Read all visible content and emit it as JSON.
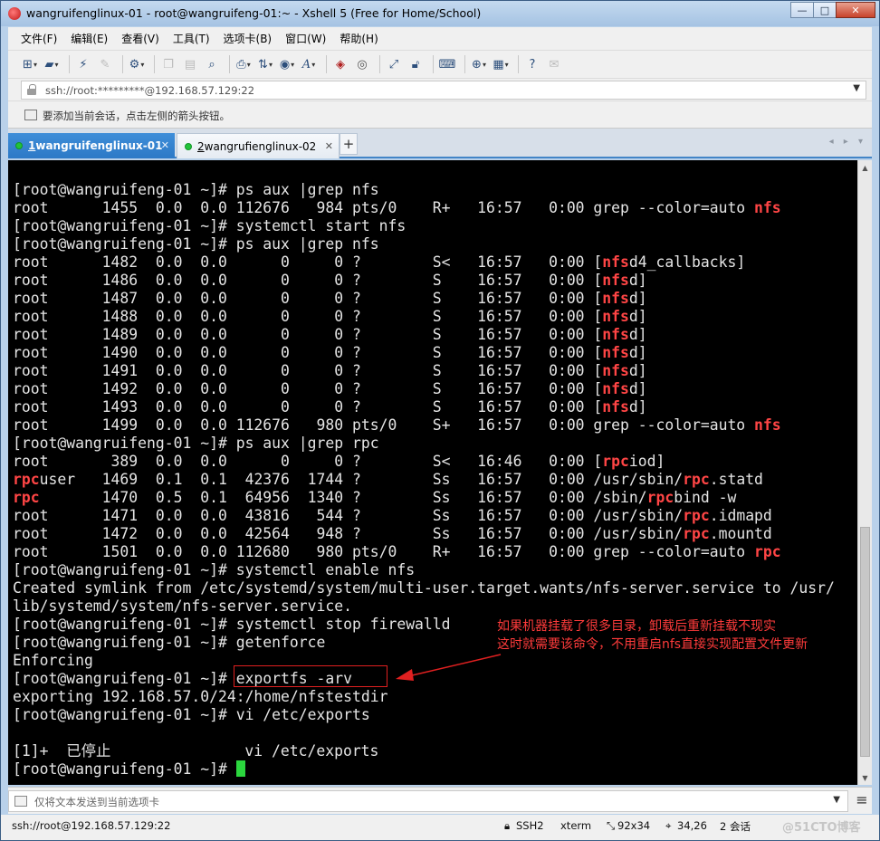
{
  "window": {
    "title": "wangruifenglinux-01 - root@wangruifeng-01:~ - Xshell 5 (Free for Home/School)",
    "buttons": {
      "minimize": "—",
      "maximize": "□",
      "close": "✕"
    }
  },
  "menu": [
    {
      "label": "文件(F)"
    },
    {
      "label": "编辑(E)"
    },
    {
      "label": "查看(V)"
    },
    {
      "label": "工具(T)"
    },
    {
      "label": "选项卡(B)"
    },
    {
      "label": "窗口(W)"
    },
    {
      "label": "帮助(H)"
    }
  ],
  "address": {
    "value": "ssh://root:*********@192.168.57.129:22"
  },
  "hint": {
    "text": "要添加当前会话，点击左侧的箭头按钮。"
  },
  "tabs": [
    {
      "prefix": "1",
      "label": " wangruifenglinux-01",
      "close": "✕"
    },
    {
      "prefix": "2",
      "label": " wangrufienglinux-02",
      "close": "✕"
    }
  ],
  "tab_add": "+",
  "tab_nav": "◂ ▸ ▾",
  "terminal": {
    "lines": [
      [
        {
          "t": "[root@wangruifeng-01 ~]# ps aux |grep nfs"
        }
      ],
      [
        {
          "t": "root      1455  0.0  0.0 112676   984 pts/0    R+   16:57   0:00 grep --color=auto "
        },
        {
          "t": "nfs",
          "h": true
        }
      ],
      [
        {
          "t": "[root@wangruifeng-01 ~]# systemctl start nfs"
        }
      ],
      [
        {
          "t": "[root@wangruifeng-01 ~]# ps aux |grep nfs"
        }
      ],
      [
        {
          "t": "root      1482  0.0  0.0      0     0 ?        S<   16:57   0:00 ["
        },
        {
          "t": "nfs",
          "h": true
        },
        {
          "t": "d4_callbacks]"
        }
      ],
      [
        {
          "t": "root      1486  0.0  0.0      0     0 ?        S    16:57   0:00 ["
        },
        {
          "t": "nfs",
          "h": true
        },
        {
          "t": "d]"
        }
      ],
      [
        {
          "t": "root      1487  0.0  0.0      0     0 ?        S    16:57   0:00 ["
        },
        {
          "t": "nfs",
          "h": true
        },
        {
          "t": "d]"
        }
      ],
      [
        {
          "t": "root      1488  0.0  0.0      0     0 ?        S    16:57   0:00 ["
        },
        {
          "t": "nfs",
          "h": true
        },
        {
          "t": "d]"
        }
      ],
      [
        {
          "t": "root      1489  0.0  0.0      0     0 ?        S    16:57   0:00 ["
        },
        {
          "t": "nfs",
          "h": true
        },
        {
          "t": "d]"
        }
      ],
      [
        {
          "t": "root      1490  0.0  0.0      0     0 ?        S    16:57   0:00 ["
        },
        {
          "t": "nfs",
          "h": true
        },
        {
          "t": "d]"
        }
      ],
      [
        {
          "t": "root      1491  0.0  0.0      0     0 ?        S    16:57   0:00 ["
        },
        {
          "t": "nfs",
          "h": true
        },
        {
          "t": "d]"
        }
      ],
      [
        {
          "t": "root      1492  0.0  0.0      0     0 ?        S    16:57   0:00 ["
        },
        {
          "t": "nfs",
          "h": true
        },
        {
          "t": "d]"
        }
      ],
      [
        {
          "t": "root      1493  0.0  0.0      0     0 ?        S    16:57   0:00 ["
        },
        {
          "t": "nfs",
          "h": true
        },
        {
          "t": "d]"
        }
      ],
      [
        {
          "t": "root      1499  0.0  0.0 112676   980 pts/0    S+   16:57   0:00 grep --color=auto "
        },
        {
          "t": "nfs",
          "h": true
        }
      ],
      [
        {
          "t": "[root@wangruifeng-01 ~]# ps aux |grep rpc"
        }
      ],
      [
        {
          "t": "root       389  0.0  0.0      0     0 ?        S<   16:46   0:00 ["
        },
        {
          "t": "rpc",
          "h": true
        },
        {
          "t": "iod]"
        }
      ],
      [
        {
          "t": "rpc",
          "h": true
        },
        {
          "t": "user   1469  0.1  0.1  42376  1744 ?        Ss   16:57   0:00 /usr/sbin/"
        },
        {
          "t": "rpc",
          "h": true
        },
        {
          "t": ".statd"
        }
      ],
      [
        {
          "t": "rpc",
          "h": true
        },
        {
          "t": "       1470  0.5  0.1  64956  1340 ?        Ss   16:57   0:00 /sbin/"
        },
        {
          "t": "rpc",
          "h": true
        },
        {
          "t": "bind -w"
        }
      ],
      [
        {
          "t": "root      1471  0.0  0.0  43816   544 ?        Ss   16:57   0:00 /usr/sbin/"
        },
        {
          "t": "rpc",
          "h": true
        },
        {
          "t": ".idmapd"
        }
      ],
      [
        {
          "t": "root      1472  0.0  0.0  42564   948 ?        Ss   16:57   0:00 /usr/sbin/"
        },
        {
          "t": "rpc",
          "h": true
        },
        {
          "t": ".mountd"
        }
      ],
      [
        {
          "t": "root      1501  0.0  0.0 112680   980 pts/0    R+   16:57   0:00 grep --color=auto "
        },
        {
          "t": "rpc",
          "h": true
        }
      ],
      [
        {
          "t": "[root@wangruifeng-01 ~]# systemctl enable nfs"
        }
      ],
      [
        {
          "t": "Created symlink from /etc/systemd/system/multi-user.target.wants/nfs-server.service to /usr/"
        }
      ],
      [
        {
          "t": "lib/systemd/system/nfs-server.service."
        }
      ],
      [
        {
          "t": "[root@wangruifeng-01 ~]# systemctl stop firewalld"
        }
      ],
      [
        {
          "t": "[root@wangruifeng-01 ~]# getenforce"
        }
      ],
      [
        {
          "t": "Enforcing"
        }
      ],
      [
        {
          "t": "[root@wangruifeng-01 ~]# exportfs -arv"
        }
      ],
      [
        {
          "t": "exporting 192.168.57.0/24:/home/nfstestdir"
        }
      ],
      [
        {
          "t": "[root@wangruifeng-01 ~]# vi /etc/exports"
        }
      ],
      [
        {
          "t": ""
        }
      ],
      [
        {
          "t": "[1]+  已停止               vi /etc/exports"
        }
      ],
      [
        {
          "t": "[root@wangruifeng-01 ~]# "
        }
      ]
    ],
    "annotation": [
      "如果机器挂载了很多目录，卸载后重新挂载不现实",
      "这时就需要该命令，不用重启nfs直接实现配置文件更新"
    ],
    "colors": {
      "highlight": "#ff4545",
      "cursor": "#2bd63e",
      "annotation": "#ff3b3b"
    }
  },
  "send": {
    "placeholder": "仅将文本发送到当前选项卡"
  },
  "status": {
    "connection": "ssh://root@192.168.57.129:22",
    "protocol": "SSH2",
    "term": "xterm",
    "size": "92x34",
    "cursor_pos": "34,26",
    "sessions": "2 会话",
    "watermark": "@51CTO博客"
  }
}
